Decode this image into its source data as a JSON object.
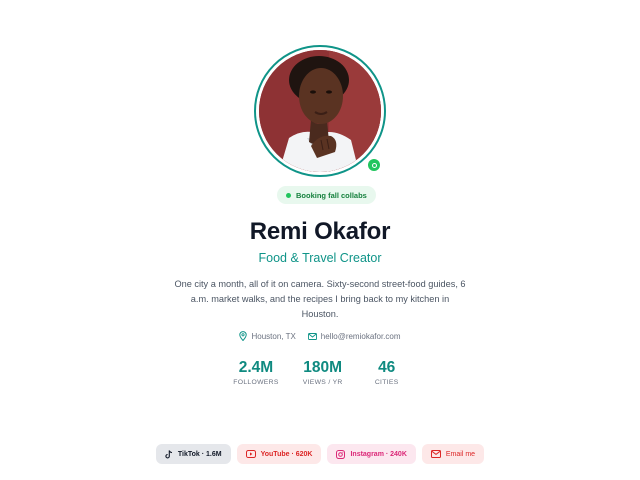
{
  "profile": {
    "avatar_alt": "Remi Okafor",
    "status": "Booking fall collabs",
    "name": "Remi Okafor",
    "role": "Food & Travel Creator",
    "bio": "One city a month, all of it on camera. Sixty-second street-food guides, 6 a.m. market walks, and the recipes I bring back to my kitchen in Houston.",
    "location": "Houston, TX",
    "email": "hello@remiokafor.com"
  },
  "stats": [
    {
      "value": "2.4M",
      "label": "FOLLOWERS"
    },
    {
      "value": "180M",
      "label": "VIEWS / YR"
    },
    {
      "value": "46",
      "label": "CITIES"
    }
  ],
  "socials": [
    {
      "label": "TikTok · 1.6M",
      "icon": "tiktok-icon"
    },
    {
      "label": "YouTube · 620K",
      "icon": "youtube-icon"
    },
    {
      "label": "Instagram · 240K",
      "icon": "instagram-icon"
    },
    {
      "label": "Email me",
      "icon": "mail-icon"
    }
  ],
  "colors": {
    "accent": "#0f9488",
    "online": "#22c55e",
    "youtube": "#dc2626",
    "instagram": "#db2777"
  }
}
